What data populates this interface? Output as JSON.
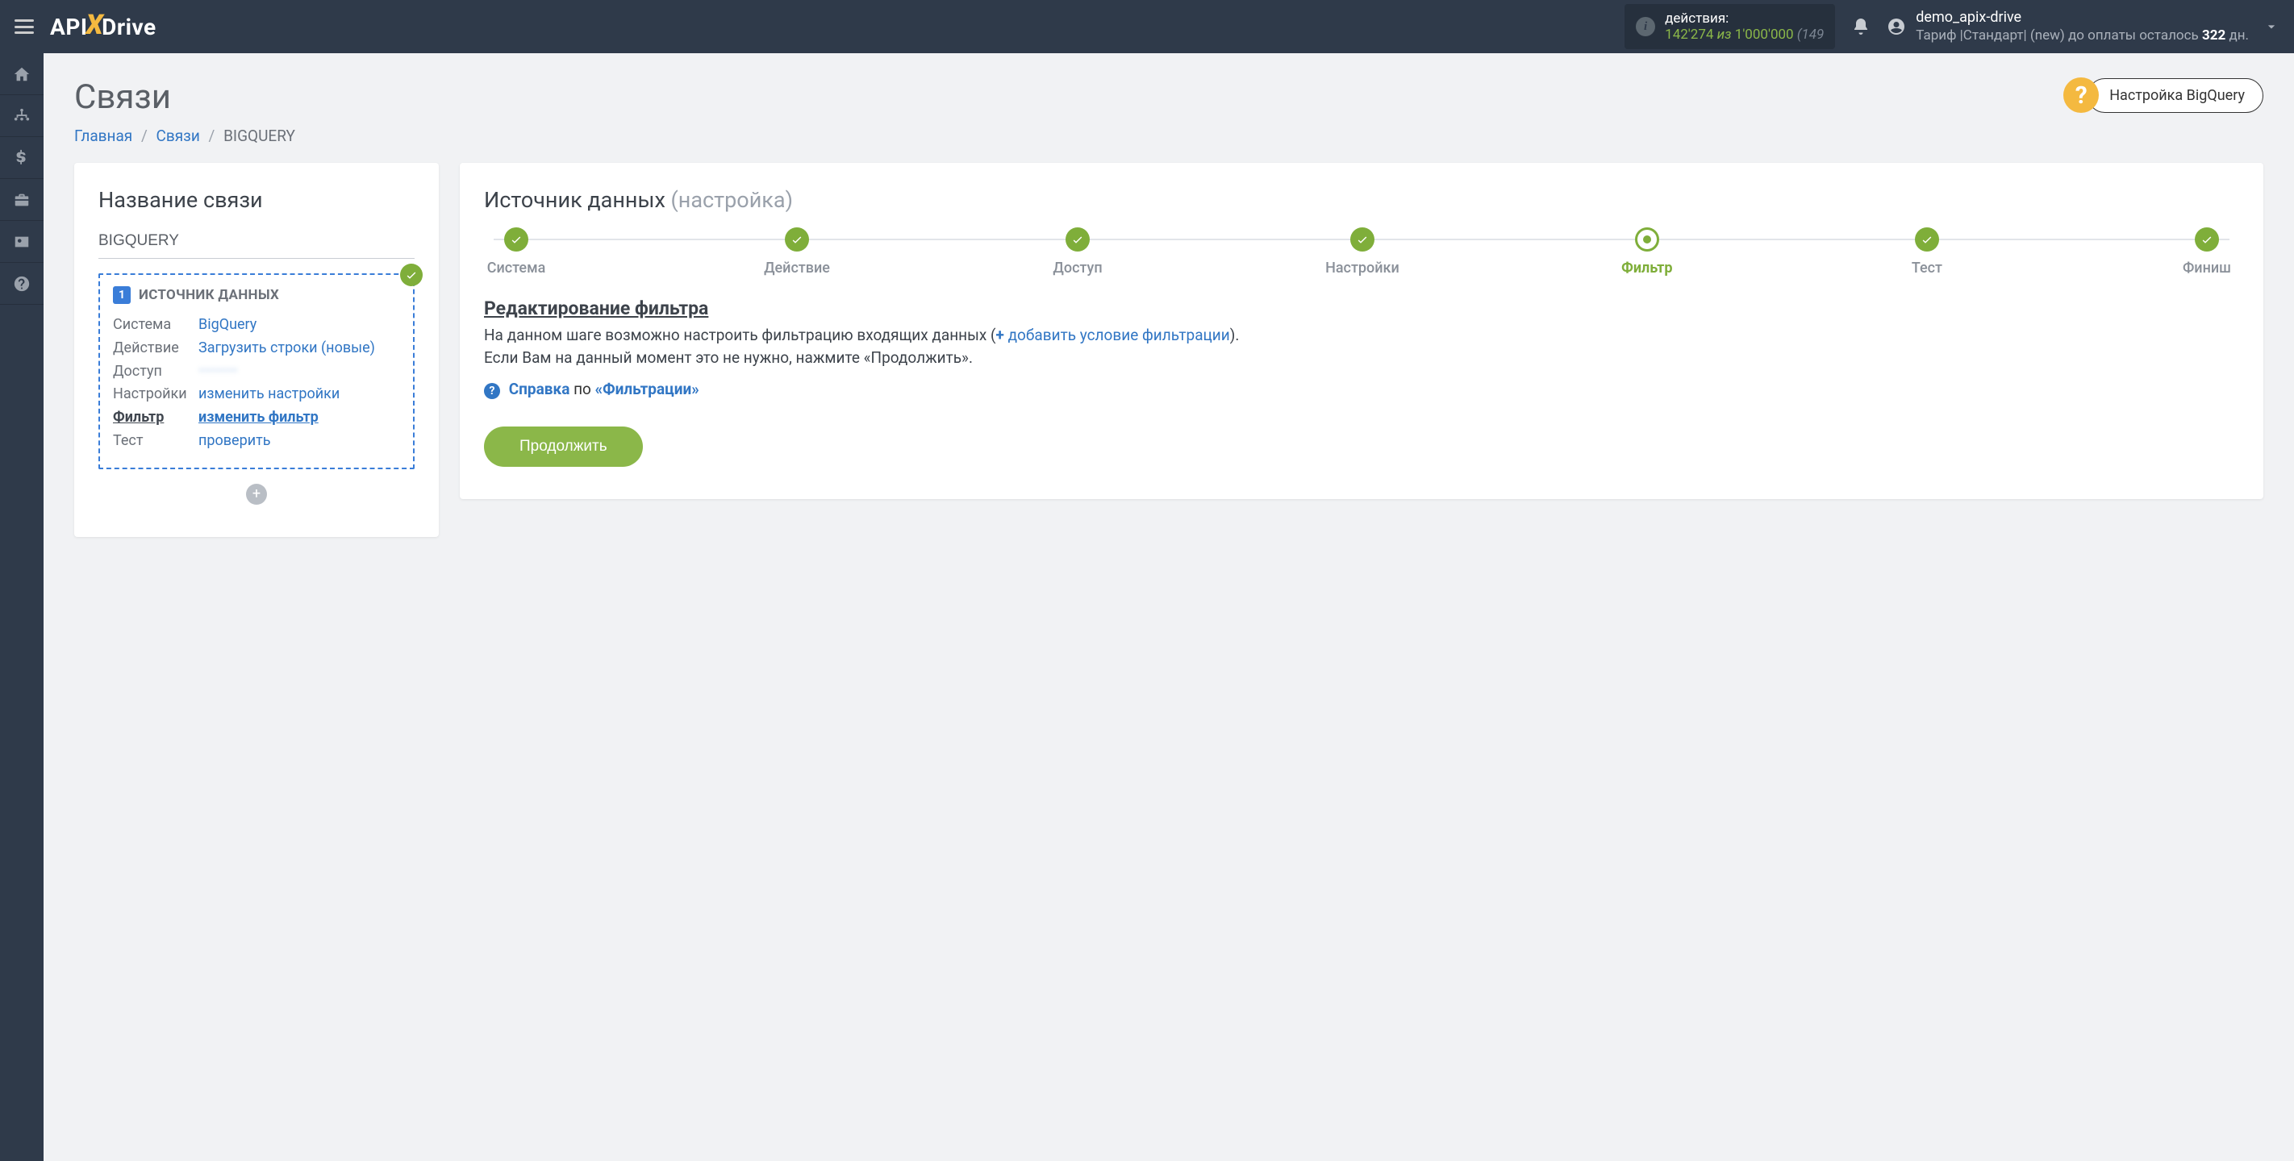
{
  "topbar": {
    "actions_label": "действия:",
    "actions_used": "142'274",
    "actions_iz": "из",
    "actions_total": "1'000'000",
    "actions_tail": "(149",
    "user_name": "demo_apix-drive",
    "plan_prefix": "Тариф |Стандарт| (new) до оплаты осталось ",
    "plan_days": "322",
    "plan_suffix": " дн."
  },
  "page": {
    "title": "Связи",
    "help_button": "Настройка BigQuery"
  },
  "breadcrumb": {
    "home": "Главная",
    "links": "Связи",
    "current": "BIGQUERY"
  },
  "left": {
    "title": "Название связи",
    "conn_name": "BIGQUERY",
    "source_num": "1",
    "source_head": "ИСТОЧНИК ДАННЫХ",
    "rows": [
      {
        "key": "Система",
        "val": "BigQuery"
      },
      {
        "key": "Действие",
        "val": "Загрузить строки (новые)"
      },
      {
        "key": "Доступ",
        "val": "••••••••"
      },
      {
        "key": "Настройки",
        "val": "изменить настройки"
      },
      {
        "key": "Фильтр",
        "val": "изменить фильтр"
      },
      {
        "key": "Тест",
        "val": "проверить"
      }
    ]
  },
  "right": {
    "title_main": "Источник данных ",
    "title_sub": "(настройка)",
    "steps": [
      {
        "label": "Система",
        "state": "done"
      },
      {
        "label": "Действие",
        "state": "done"
      },
      {
        "label": "Доступ",
        "state": "done"
      },
      {
        "label": "Настройки",
        "state": "done"
      },
      {
        "label": "Фильтр",
        "state": "current"
      },
      {
        "label": "Тест",
        "state": "done"
      },
      {
        "label": "Финиш",
        "state": "done"
      }
    ],
    "heading": "Редактирование фильтра",
    "para1_a": "На данном шаге возможно настроить фильтрацию входящих данных (",
    "para1_link": "добавить условие фильтрации",
    "para1_b": ").",
    "para2": "Если Вам на данный момент это не нужно, нажмите «Продолжить».",
    "help_label": "Справка",
    "help_mid": " по ",
    "help_topic": "«Фильтрации»",
    "continue": "Продолжить"
  }
}
